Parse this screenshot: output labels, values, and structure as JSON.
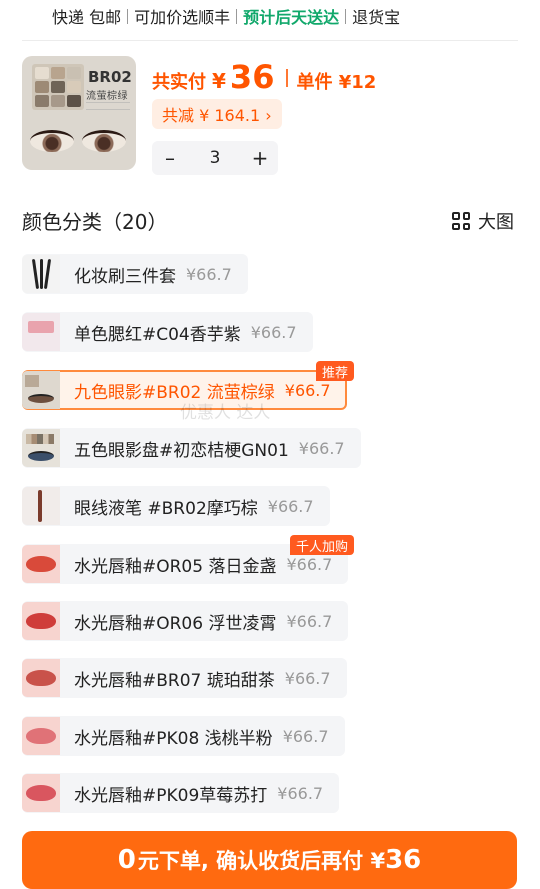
{
  "service": {
    "items": [
      "快递 包邮",
      "可加价选顺丰",
      "预计后天送达",
      "退货宝"
    ]
  },
  "product": {
    "thumb_code": "BR02",
    "thumb_subtitle": "流萤棕绿",
    "total_label": "共实付",
    "currency": "¥",
    "total_value": "36",
    "unit_label": "单件 ¥12",
    "saving_label": "共减 ¥ 164.1 ›",
    "quantity": "3",
    "minus": "–",
    "plus": "+"
  },
  "section": {
    "title": "颜色分类（20）",
    "big_view_label": "大图"
  },
  "options": [
    {
      "name": "化妆刷三件套",
      "price": "¥66.7"
    },
    {
      "name": "单色腮红#C04香芋紫",
      "price": "¥66.7"
    },
    {
      "name": "九色眼影#BR02 流萤棕绿",
      "price": "¥66.7",
      "tag": "推荐",
      "selected": true
    },
    {
      "name": "五色眼影盘#初恋桔梗GN01",
      "price": "¥66.7"
    },
    {
      "name": "眼线液笔 #BR02摩巧棕",
      "price": "¥66.7"
    },
    {
      "name": "水光唇釉#OR05 落日金盏",
      "price": "¥66.7",
      "tag": "千人加购"
    },
    {
      "name": "水光唇釉#OR06 浮世凌霄",
      "price": "¥66.7"
    },
    {
      "name": "水光唇釉#BR07 琥珀甜茶",
      "price": "¥66.7"
    },
    {
      "name": "水光唇釉#PK08 浅桃半粉",
      "price": "¥66.7"
    },
    {
      "name": "水光唇釉#PK09草莓苏打",
      "price": "¥66.7"
    }
  ],
  "watermark": "优惠人 达人",
  "cta": {
    "prefix": "0",
    "middle": "元下单, 确认收货后再付 ¥",
    "amount": "36"
  },
  "colors": {
    "accent": "#ff5500",
    "green": "#11a86b",
    "cta_bg": "#ff6a10"
  }
}
